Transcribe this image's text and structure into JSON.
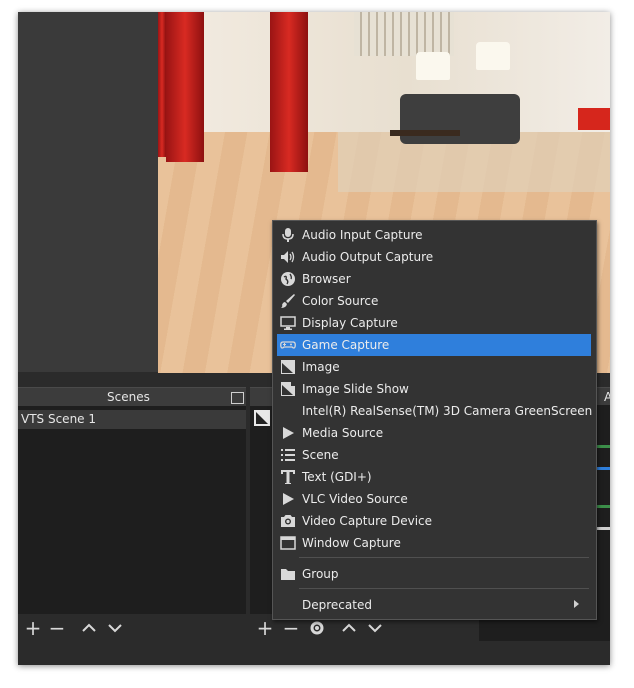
{
  "docks": {
    "scenes_title": "Scenes",
    "scene_items": [
      "VTS Scene 1"
    ],
    "right_dock_title_fragment": "A"
  },
  "menu": {
    "items": [
      {
        "label": "Audio Input Capture",
        "icon": "microphone-icon"
      },
      {
        "label": "Audio Output Capture",
        "icon": "speaker-icon"
      },
      {
        "label": "Browser",
        "icon": "globe-icon"
      },
      {
        "label": "Color Source",
        "icon": "brush-icon"
      },
      {
        "label": "Display Capture",
        "icon": "monitor-icon"
      },
      {
        "label": "Game Capture",
        "icon": "gamepad-icon",
        "selected": true
      },
      {
        "label": "Image",
        "icon": "image-icon"
      },
      {
        "label": "Image Slide Show",
        "icon": "slideshow-icon"
      },
      {
        "label": "Intel(R) RealSense(TM) 3D Camera GreenScreen",
        "icon": "blank-icon"
      },
      {
        "label": "Media Source",
        "icon": "play-icon"
      },
      {
        "label": "Scene",
        "icon": "list-icon"
      },
      {
        "label": "Text (GDI+)",
        "icon": "text-icon"
      },
      {
        "label": "VLC Video Source",
        "icon": "play-icon"
      },
      {
        "label": "Video Capture Device",
        "icon": "camera-icon"
      },
      {
        "label": "Window Capture",
        "icon": "window-icon"
      }
    ],
    "group_label": "Group",
    "deprecated_label": "Deprecated"
  },
  "colors": {
    "selection": "#2f7fdc",
    "menu_bg": "#333333",
    "panel_bg": "#1e1e1e"
  }
}
